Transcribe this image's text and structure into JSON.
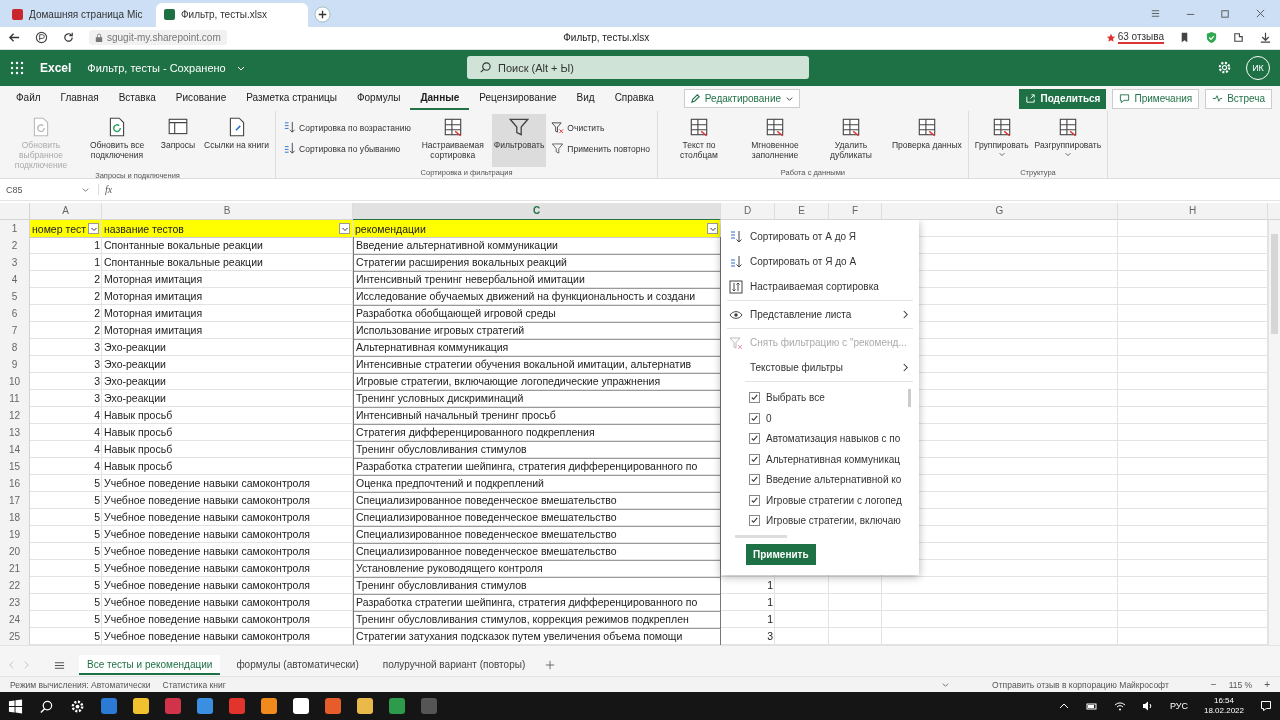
{
  "browser": {
    "tabs": [
      {
        "title": "Домашняя страница Mic",
        "selected": false
      },
      {
        "title": "Фильтр, тесты.xlsx",
        "selected": true
      }
    ],
    "url": "sgugit-my.sharepoint.com",
    "page_title": "Фильтр, тесты.xlsx",
    "reviews": "63 отзыва"
  },
  "app": {
    "name": "Excel",
    "document": "Фильтр, тесты - Сохранено",
    "search": {
      "placeholder": "Поиск (Alt + Ы)"
    },
    "avatar": "ИК"
  },
  "menu_tabs": [
    {
      "label": "Файл",
      "selected": false
    },
    {
      "label": "Главная",
      "selected": false
    },
    {
      "label": "Вставка",
      "selected": false
    },
    {
      "label": "Рисование",
      "selected": false
    },
    {
      "label": "Разметка страницы",
      "selected": false
    },
    {
      "label": "Формулы",
      "selected": false
    },
    {
      "label": "Данные",
      "selected": true
    },
    {
      "label": "Рецензирование",
      "selected": false
    },
    {
      "label": "Вид",
      "selected": false
    },
    {
      "label": "Справка",
      "selected": false
    }
  ],
  "mode": "Редактирование",
  "actions": [
    {
      "label": "Поделиться",
      "kind": "primary"
    },
    {
      "label": "Примечания",
      "kind": "outline"
    },
    {
      "label": "Встреча",
      "kind": "outline"
    }
  ],
  "ribbon": {
    "groups": [
      {
        "label": "Запросы и подключения",
        "columns": [
          {
            "kind": "large",
            "buttons": [
              {
                "label": "Обновить выбранное подключение",
                "disabled": true,
                "on": false,
                "dropdown": false
              }
            ]
          },
          {
            "kind": "large",
            "buttons": [
              {
                "label": "Обновить все подключения",
                "disabled": false,
                "on": false,
                "dropdown": false
              }
            ]
          },
          {
            "kind": "large",
            "buttons": [
              {
                "label": "Запросы",
                "disabled": false,
                "on": false,
                "dropdown": false
              }
            ]
          },
          {
            "kind": "large",
            "buttons": [
              {
                "label": "Ссылки на книги",
                "disabled": false,
                "on": false,
                "dropdown": false
              }
            ]
          }
        ]
      },
      {
        "label": "Сортировка и фильтрация",
        "columns": [
          {
            "kind": "small",
            "buttons": [
              {
                "label": "Сортировка по возрастанию",
                "disabled": false,
                "on": false,
                "dropdown": false
              },
              {
                "label": "Сортировка по убыванию",
                "disabled": false,
                "on": false,
                "dropdown": false
              }
            ]
          },
          {
            "kind": "large",
            "buttons": [
              {
                "label": "Настраиваемая сортировка",
                "disabled": false,
                "on": false,
                "dropdown": false
              }
            ]
          },
          {
            "kind": "large",
            "buttons": [
              {
                "label": "Фильтровать",
                "disabled": false,
                "on": true,
                "dropdown": false
              }
            ]
          },
          {
            "kind": "small",
            "buttons": [
              {
                "label": "Очистить",
                "disabled": false,
                "on": false,
                "dropdown": false
              },
              {
                "label": "Применить повторно",
                "disabled": false,
                "on": false,
                "dropdown": false
              }
            ]
          }
        ]
      },
      {
        "label": "Работа с данными",
        "columns": [
          {
            "kind": "large",
            "buttons": [
              {
                "label": "Текст по столбцам",
                "disabled": false,
                "on": false,
                "dropdown": false
              }
            ]
          },
          {
            "kind": "large",
            "buttons": [
              {
                "label": "Мгновенное заполнение",
                "disabled": false,
                "on": false,
                "dropdown": false
              }
            ]
          },
          {
            "kind": "large",
            "buttons": [
              {
                "label": "Удалить дубликаты",
                "disabled": false,
                "on": false,
                "dropdown": false
              }
            ]
          },
          {
            "kind": "large",
            "buttons": [
              {
                "label": "Проверка данных",
                "disabled": false,
                "on": false,
                "dropdown": false
              }
            ]
          }
        ]
      },
      {
        "label": "Структура",
        "columns": [
          {
            "kind": "large",
            "buttons": [
              {
                "label": "Группировать",
                "disabled": false,
                "on": false,
                "dropdown": true
              }
            ]
          },
          {
            "kind": "large",
            "buttons": [
              {
                "label": "Разгруппировать",
                "disabled": false,
                "on": false,
                "dropdown": true
              }
            ]
          }
        ]
      }
    ]
  },
  "formula_bar": {
    "cell": "C85",
    "function_label": "fx"
  },
  "sheet": {
    "columns": [
      {
        "label": "A",
        "selected": false
      },
      {
        "label": "B",
        "selected": false
      },
      {
        "label": "C",
        "selected": true
      },
      {
        "label": "D",
        "selected": false
      },
      {
        "label": "E",
        "selected": false
      },
      {
        "label": "F",
        "selected": false
      },
      {
        "label": "G",
        "selected": false
      },
      {
        "label": "H",
        "selected": false
      }
    ],
    "header_row": {
      "number": "1",
      "cells": [
        "номер тест",
        "название тестов",
        "рекомендации"
      ]
    },
    "rows": [
      {
        "number": "2",
        "cells": [
          "1",
          "Спонтанные вокальные реакции",
          "Введение альтернативной коммуникации"
        ]
      },
      {
        "number": "3",
        "cells": [
          "1",
          "Спонтанные вокальные реакции",
          "Стратегии расширения вокальных реакций"
        ]
      },
      {
        "number": "4",
        "cells": [
          "2",
          "Моторная имитация",
          "Интенсивный тренинг невербальной имитации"
        ]
      },
      {
        "number": "5",
        "cells": [
          "2",
          "Моторная имитация",
          "Исследование обучаемых движений на функциональность и создани"
        ]
      },
      {
        "number": "6",
        "cells": [
          "2",
          "Моторная имитация",
          "Разработка обобщающей игровой среды"
        ]
      },
      {
        "number": "7",
        "cells": [
          "2",
          "Моторная имитация",
          "Использование игровых стратегий"
        ]
      },
      {
        "number": "8",
        "cells": [
          "3",
          "Эхо-реакции",
          "Альтернативная коммуникация"
        ]
      },
      {
        "number": "9",
        "cells": [
          "3",
          "Эхо-реакции",
          "Интенсивные стратегии обучения вокальной имитации, альтернатив"
        ]
      },
      {
        "number": "10",
        "cells": [
          "3",
          "Эхо-реакции",
          "Игровые стратегии, включающие логопедические упражнения"
        ]
      },
      {
        "number": "11",
        "cells": [
          "3",
          "Эхо-реакции",
          "Тренинг условных дискриминаций"
        ]
      },
      {
        "number": "12",
        "cells": [
          "4",
          "Навык просьб",
          "Интенсивный начальный тренинг просьб"
        ]
      },
      {
        "number": "13",
        "cells": [
          "4",
          "Навык просьб",
          "Стратегия дифференцированного подкрепления"
        ]
      },
      {
        "number": "14",
        "cells": [
          "4",
          "Навык просьб",
          "Тренинг обусловливания стимулов"
        ]
      },
      {
        "number": "15",
        "cells": [
          "4",
          "Навык просьб",
          "Разработка стратегии шейпинга, стратегия дифференцированного по"
        ]
      },
      {
        "number": "16",
        "cells": [
          "5",
          "Учебное поведение навыки самоконтроля",
          "Оценка предпочтений и подкреплений"
        ]
      },
      {
        "number": "17",
        "cells": [
          "5",
          "Учебное поведение навыки самоконтроля",
          "Специализированное поведенческое вмешательство"
        ]
      },
      {
        "number": "18",
        "cells": [
          "5",
          "Учебное поведение навыки самоконтроля",
          "Специализированное поведенческое вмешательство"
        ]
      },
      {
        "number": "19",
        "cells": [
          "5",
          "Учебное поведение навыки самоконтроля",
          "Специализированное поведенческое вмешательство"
        ]
      },
      {
        "number": "20",
        "cells": [
          "5",
          "Учебное поведение навыки самоконтроля",
          "Специализированное поведенческое вмешательство"
        ]
      },
      {
        "number": "21",
        "cells": [
          "5",
          "Учебное поведение навыки самоконтроля",
          "Установление руководящего контроля"
        ]
      },
      {
        "number": "22",
        "cells": [
          "5",
          "Учебное поведение навыки самоконтроля",
          "Тренинг обусловливания стимулов",
          "1"
        ]
      },
      {
        "number": "23",
        "cells": [
          "5",
          "Учебное поведение навыки самоконтроля",
          "Разработка стратегии шейпинга, стратегия дифференцированного по",
          "1"
        ]
      },
      {
        "number": "24",
        "cells": [
          "5",
          "Учебное поведение навыки самоконтроля",
          "Тренинг обусловливания стимулов, коррекция режимов подкреплен",
          "1"
        ]
      },
      {
        "number": "25",
        "cells": [
          "5",
          "Учебное поведение навыки самоконтроля",
          "Стратегии затухания подсказок путем увеличения объема помощи",
          "3"
        ]
      }
    ]
  },
  "filter_menu": {
    "items": [
      {
        "label": "Сортировать от А до Я",
        "disabled": false,
        "submenu": false
      },
      {
        "label": "Сортировать от Я до А",
        "disabled": false,
        "submenu": false
      },
      {
        "label": "Настраиваемая сортировка",
        "disabled": false,
        "submenu": false
      },
      {
        "label": "Представление листа",
        "disabled": false,
        "submenu": true
      },
      {
        "label": "Снять фильтрацию с \"рекоменд...",
        "disabled": true,
        "submenu": false
      },
      {
        "label": "Текстовые фильтры",
        "disabled": false,
        "submenu": true
      }
    ],
    "values": [
      {
        "label": "Выбрать все",
        "checked": true
      },
      {
        "label": "0",
        "checked": true
      },
      {
        "label": "Автоматизация навыков с по",
        "checked": true
      },
      {
        "label": "Альтернативная коммуникац",
        "checked": true
      },
      {
        "label": "Введение альтернативной ко",
        "checked": true
      },
      {
        "label": "Игровые стратегии с логопед",
        "checked": true
      },
      {
        "label": "Игровые стратегии, включаю",
        "checked": true
      }
    ],
    "apply": "Применить"
  },
  "sheet_tabs": [
    {
      "label": "Все тесты и рекомендации",
      "selected": true
    },
    {
      "label": "формулы (автоматически)",
      "selected": false
    },
    {
      "label": "полуручной вариант (повторы)",
      "selected": false
    }
  ],
  "status_bar": {
    "items": [
      "Режим вычисления: Автоматически",
      "Статистика книг"
    ],
    "feedback": "Отправить отзыв в корпорацию Майкрософт",
    "zoom_out": "−",
    "zoom": "115 %",
    "zoom_in": "+"
  },
  "taskbar": {
    "language": "РУС",
    "time": "16:54",
    "date": "18.02.2022"
  }
}
